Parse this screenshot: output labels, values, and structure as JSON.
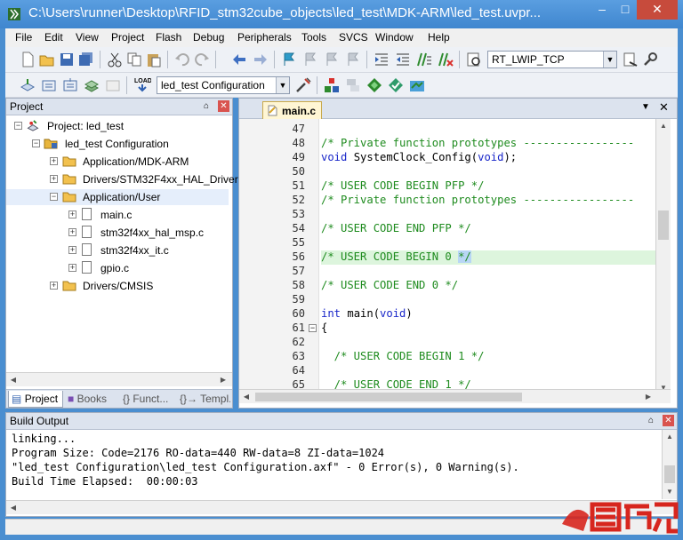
{
  "window": {
    "title": "C:\\Users\\runner\\Desktop\\RFID_stm32cube_objects\\led_test\\MDK-ARM\\led_test.uvpr..."
  },
  "menu": [
    "File",
    "Edit",
    "View",
    "Project",
    "Flash",
    "Debug",
    "Peripherals",
    "Tools",
    "SVCS",
    "Window",
    "Help"
  ],
  "toolbar": {
    "target_combo": "RT_LWIP_TCP",
    "config_combo": "led_test Configuration"
  },
  "project_panel": {
    "title": "Project",
    "tree": [
      {
        "label": "Project: led_test"
      },
      {
        "label": "led_test Configuration"
      },
      {
        "label": "Application/MDK-ARM"
      },
      {
        "label": "Drivers/STM32F4xx_HAL_Driver"
      },
      {
        "label": "Application/User"
      },
      {
        "label": "main.c"
      },
      {
        "label": "stm32f4xx_hal_msp.c"
      },
      {
        "label": "stm32f4xx_it.c"
      },
      {
        "label": "gpio.c"
      },
      {
        "label": "Drivers/CMSIS"
      }
    ],
    "tabs": [
      "Project",
      "Books",
      "{} Funct...",
      "{}→ Templ..."
    ]
  },
  "editor": {
    "active_tab": "main.c",
    "lines": [
      {
        "num": "47",
        "text": ""
      },
      {
        "num": "48",
        "text": "/* Private function prototypes -----------------"
      },
      {
        "num": "49",
        "text": "void SystemClock_Config(void);"
      },
      {
        "num": "50",
        "text": ""
      },
      {
        "num": "51",
        "text": "/* USER CODE BEGIN PFP */"
      },
      {
        "num": "52",
        "text": "/* Private function prototypes -----------------"
      },
      {
        "num": "53",
        "text": ""
      },
      {
        "num": "54",
        "text": "/* USER CODE END PFP */"
      },
      {
        "num": "55",
        "text": ""
      },
      {
        "num": "56",
        "text": "/* USER CODE BEGIN 0 */"
      },
      {
        "num": "57",
        "text": ""
      },
      {
        "num": "58",
        "text": "/* USER CODE END 0 */"
      },
      {
        "num": "59",
        "text": ""
      },
      {
        "num": "60",
        "text": "int main(void)"
      },
      {
        "num": "61",
        "text": "{"
      },
      {
        "num": "62",
        "text": ""
      },
      {
        "num": "63",
        "text": "  /* USER CODE BEGIN 1 */"
      },
      {
        "num": "64",
        "text": ""
      },
      {
        "num": "65",
        "text": "  /* USER CODE END 1 */"
      }
    ]
  },
  "build_output": {
    "title": "Build Output",
    "lines": [
      "linking...",
      "Program Size: Code=2176 RO-data=440 RW-data=8 ZI-data=1024",
      "\"led_test Configuration\\led_test Configuration.axf\" - 0 Error(s), 0 Warning(s).",
      "Build Time Elapsed:  00:00:03"
    ]
  },
  "colors": {
    "titlebar": "#4a8ed0",
    "comment": "#1e8b1e",
    "keyword": "#1a27c9",
    "current_line": "#ddf5dd",
    "close_button": "#c74b3c"
  }
}
